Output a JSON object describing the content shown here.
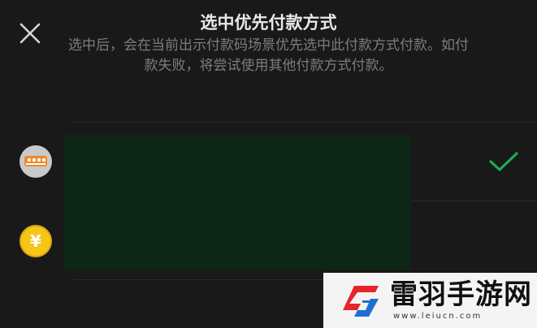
{
  "header": {
    "close_icon": "close-icon",
    "title": "选中优先付款方式",
    "description": "选中后，会在当前出示付款码场景优先选中此付款方式付款。如付款失败，将尝试使用其他付款方式付款。"
  },
  "payment_methods": [
    {
      "icon": "bus-card-icon",
      "icon_color": "#f08a24",
      "selected": true
    },
    {
      "icon": "yuan-coin-icon",
      "icon_glyph": "¥",
      "icon_color": "#f5c518",
      "selected": false
    }
  ],
  "colors": {
    "background": "#191919",
    "check": "#1aad5b",
    "redaction": "#0d2616"
  },
  "watermark": {
    "brand": "雷羽手游网",
    "url": "www.leiucn.com"
  }
}
